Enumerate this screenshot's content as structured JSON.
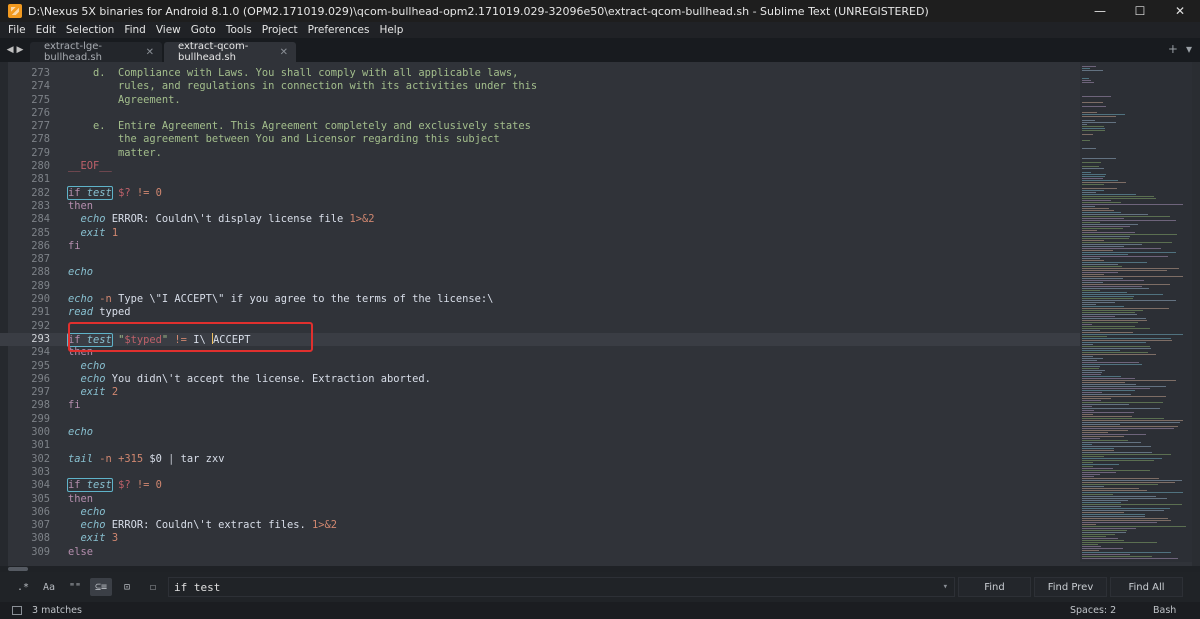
{
  "window": {
    "title": "D:\\Nexus 5X binaries for Android 8.1.0 (OPM2.171019.029)\\qcom-bullhead-opm2.171019.029-32096e50\\extract-qcom-bullhead.sh - Sublime Text (UNREGISTERED)",
    "minimize": "—",
    "maximize": "☐",
    "close": "✕"
  },
  "menu": [
    "File",
    "Edit",
    "Selection",
    "Find",
    "View",
    "Goto",
    "Tools",
    "Project",
    "Preferences",
    "Help"
  ],
  "tabs": [
    {
      "label": "extract-lge-bullhead.sh",
      "active": false
    },
    {
      "label": "extract-qcom-bullhead.sh",
      "active": true
    }
  ],
  "tab_actions": {
    "new": "+",
    "more": "▾"
  },
  "code": {
    "lines": [
      {
        "n": "273",
        "text": "    d.  Compliance with Laws. You shall comply with all applicable laws,"
      },
      {
        "n": "274",
        "text": "        rules, and regulations in connection with its activities under this"
      },
      {
        "n": "275",
        "text": "        Agreement."
      },
      {
        "n": "276",
        "text": ""
      },
      {
        "n": "277",
        "text": "    e.  Entire Agreement. This Agreement completely and exclusively states"
      },
      {
        "n": "278",
        "text": "        the agreement between You and Licensor regarding this subject"
      },
      {
        "n": "279",
        "text": "        matter."
      },
      {
        "n": "280",
        "text": "__EOF__"
      },
      {
        "n": "281",
        "text": ""
      },
      {
        "n": "282",
        "text": "if test $? != 0"
      },
      {
        "n": "283",
        "text": "then"
      },
      {
        "n": "284",
        "text": "  echo ERROR: Couldn\\'t display license file 1>&2"
      },
      {
        "n": "285",
        "text": "  exit 1"
      },
      {
        "n": "286",
        "text": "fi"
      },
      {
        "n": "287",
        "text": ""
      },
      {
        "n": "288",
        "text": "echo"
      },
      {
        "n": "289",
        "text": ""
      },
      {
        "n": "290",
        "text": "echo -n Type \\\"I ACCEPT\\\" if you agree to the terms of the license:\\ "
      },
      {
        "n": "291",
        "text": "read typed"
      },
      {
        "n": "292",
        "text": ""
      },
      {
        "n": "293",
        "text": "if test \"$typed\" != I\\ ACCEPT"
      },
      {
        "n": "294",
        "text": "then"
      },
      {
        "n": "295",
        "text": "  echo"
      },
      {
        "n": "296",
        "text": "  echo You didn\\'t accept the license. Extraction aborted."
      },
      {
        "n": "297",
        "text": "  exit 2"
      },
      {
        "n": "298",
        "text": "fi"
      },
      {
        "n": "299",
        "text": ""
      },
      {
        "n": "300",
        "text": "echo"
      },
      {
        "n": "301",
        "text": ""
      },
      {
        "n": "302",
        "text": "tail -n +315 $0 | tar zxv"
      },
      {
        "n": "303",
        "text": ""
      },
      {
        "n": "304",
        "text": "if test $? != 0"
      },
      {
        "n": "305",
        "text": "then"
      },
      {
        "n": "306",
        "text": "  echo"
      },
      {
        "n": "307",
        "text": "  echo ERROR: Couldn\\'t extract files. 1>&2"
      },
      {
        "n": "308",
        "text": "  exit 3"
      },
      {
        "n": "309",
        "text": "else"
      }
    ]
  },
  "find": {
    "options": [
      ".*",
      "Aa",
      "\"\"",
      "⊆≡",
      "⊡",
      "☐"
    ],
    "query": "if test",
    "dropdown": "▾",
    "buttons": {
      "find": "Find",
      "find_prev": "Find Prev",
      "find_all": "Find All"
    }
  },
  "status": {
    "matches": "3 matches",
    "spaces": "Spaces: 2",
    "syntax": "Bash"
  },
  "colors": {
    "editor_bg": "#303339",
    "highlight_box": "#e0302e",
    "cursor": "#f0c060"
  }
}
